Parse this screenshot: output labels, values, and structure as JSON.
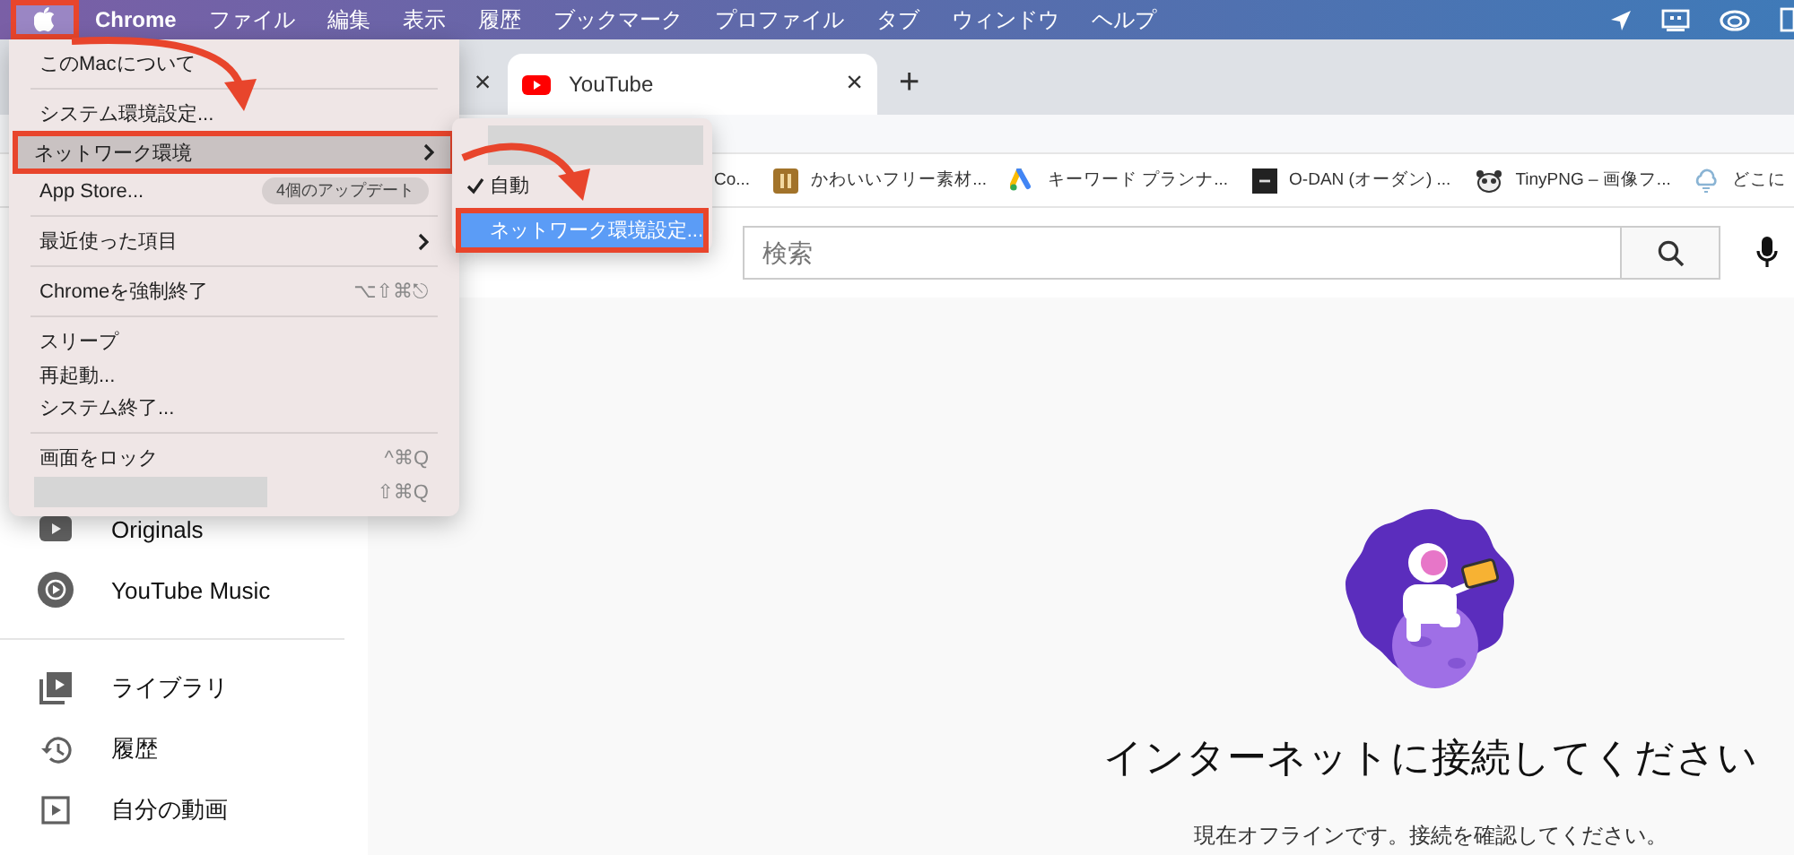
{
  "menu_bar": {
    "items": [
      {
        "kind": "apple",
        "selected": true
      },
      {
        "kind": "app",
        "label": "Chrome",
        "selected": false
      },
      {
        "kind": "menu",
        "label": "ファイル",
        "selected": false
      },
      {
        "kind": "menu",
        "label": "編集",
        "selected": false
      },
      {
        "kind": "menu",
        "label": "表示",
        "selected": false
      },
      {
        "kind": "menu",
        "label": "履歴",
        "selected": false
      },
      {
        "kind": "menu",
        "label": "ブックマーク",
        "selected": false
      },
      {
        "kind": "menu",
        "label": "プロファイル",
        "selected": false
      },
      {
        "kind": "menu",
        "label": "タブ",
        "selected": false
      },
      {
        "kind": "menu",
        "label": "ウィンドウ",
        "selected": false
      },
      {
        "kind": "menu",
        "label": "ヘルプ",
        "selected": false
      }
    ]
  },
  "tabs": [
    {
      "kind": "partial",
      "close": "×",
      "selected": false
    },
    {
      "kind": "youtube",
      "title": "YouTube",
      "close": "×",
      "selected": true
    }
  ],
  "new_tab": "+",
  "bookmarks": [
    {
      "kind": "plain",
      "label": "Co..."
    },
    {
      "kind": "tile",
      "label": "かわいいフリー素材..."
    },
    {
      "kind": "triangle",
      "label": "キーワード プランナ..."
    },
    {
      "kind": "dark",
      "label": "O-DAN (オーダン) ..."
    },
    {
      "kind": "animal",
      "label": "TinyPNG – 画像フ..."
    },
    {
      "kind": "cloud",
      "label": "どこに"
    }
  ],
  "search": {
    "placeholder": "検索"
  },
  "sidebar": {
    "items": [
      {
        "kind": "originals",
        "label": "Originals"
      },
      {
        "kind": "music",
        "label": "YouTube Music"
      },
      {
        "kind": "separator"
      },
      {
        "kind": "library",
        "label": "ライブラリ"
      },
      {
        "kind": "history",
        "label": "履歴"
      },
      {
        "kind": "videos",
        "label": "自分の動画"
      }
    ]
  },
  "offline": {
    "title": "インターネットに接続してください",
    "message": "現在オフラインです。接続を確認してください。"
  },
  "apple_menu": {
    "items": [
      {
        "kind": "item",
        "label": "このMacについて",
        "selected": false,
        "submenu": false,
        "annotated": false
      },
      {
        "kind": "separator"
      },
      {
        "kind": "item",
        "label": "システム環境設定...",
        "selected": false,
        "submenu": false,
        "annotated": false
      },
      {
        "kind": "item",
        "label": "ネットワーク環境",
        "selected": true,
        "submenu": true,
        "annotated": true
      },
      {
        "kind": "item",
        "label": "App Store...",
        "badge": "4個のアップデート",
        "selected": false,
        "submenu": false,
        "annotated": false
      },
      {
        "kind": "separator"
      },
      {
        "kind": "item",
        "label": "最近使った項目",
        "selected": false,
        "submenu": true,
        "annotated": false
      },
      {
        "kind": "separator"
      },
      {
        "kind": "item",
        "label": "Chromeを強制終了",
        "shortcut": "⌥⇧⌘⎋",
        "selected": false,
        "submenu": false,
        "annotated": false
      },
      {
        "kind": "separator"
      },
      {
        "kind": "item",
        "label": "スリープ",
        "selected": false,
        "submenu": false,
        "annotated": false
      },
      {
        "kind": "item",
        "label": "再起動...",
        "selected": false,
        "submenu": false,
        "annotated": false
      },
      {
        "kind": "item",
        "label": "システム終了...",
        "selected": false,
        "submenu": false,
        "annotated": false
      },
      {
        "kind": "separator"
      },
      {
        "kind": "item",
        "label": "画面をロック",
        "shortcut": "^⌘Q",
        "selected": false,
        "submenu": false,
        "annotated": false
      },
      {
        "kind": "redacted",
        "shortcut": "⇧⌘Q"
      }
    ]
  },
  "submenu": {
    "items": [
      {
        "kind": "redacted"
      },
      {
        "kind": "item",
        "label": "自動",
        "checked": true,
        "selected": false,
        "annotated": false
      },
      {
        "kind": "item",
        "label": "ネットワーク環境設定...",
        "checked": false,
        "selected": true,
        "annotated": true
      }
    ]
  }
}
